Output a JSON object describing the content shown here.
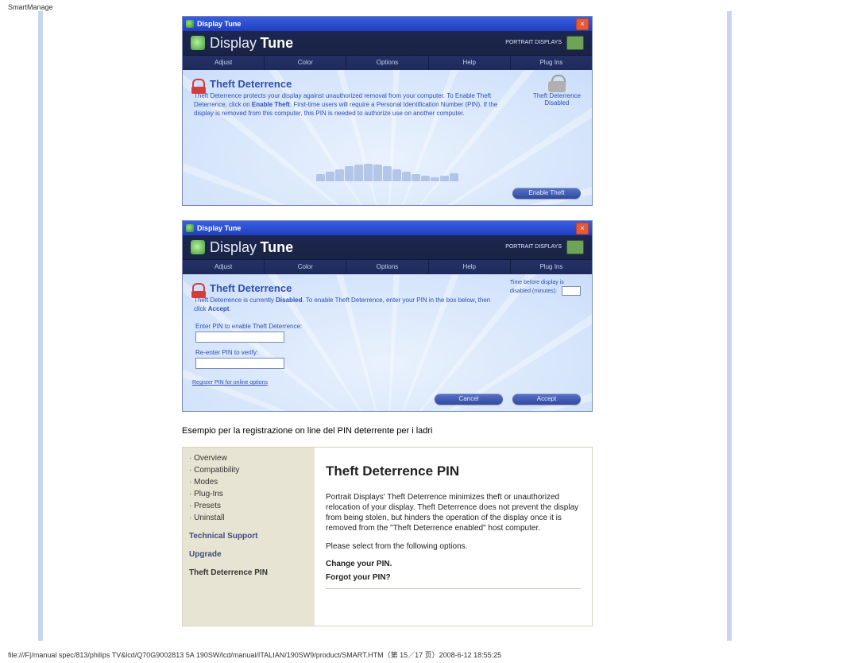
{
  "header": {
    "title": "SmartManage"
  },
  "app_common": {
    "window_title": "Display Tune",
    "brand_a": "Display",
    "brand_b": "Tune",
    "brand_label": "PORTRAIT\nDISPLAYS",
    "close_glyph": "×"
  },
  "window1": {
    "tabs": [
      "Adjust",
      "Color",
      "Options",
      "Help",
      "Plug Ins"
    ],
    "panel_title": "Theft Deterrence",
    "panel_desc": "Theft Deterrence protects your display against unauthorized removal from your computer. To Enable Theft Deterrence, click on <b>Enable Theft</b>. First-time users will require a Personal Identification Number (PIN). If the display is removed from this computer, this PIN is needed to authorize use on another computer.",
    "status_line1": "Theft Deterrence",
    "status_line2": "Disabled",
    "button": "Enable Theft"
  },
  "window2": {
    "tabs": [
      "Adjust",
      "Color",
      "Options",
      "Help",
      "Plug Ins"
    ],
    "panel_title": "Theft Deterrence",
    "panel_desc": "Theft Deterrence is currently <b>Disabled</b>. To enable Theft Deterrence, enter your PIN in the box below, then click <b>Accept</b>.",
    "field1_label": "Enter PIN to enable Theft Deterrence:",
    "field2_label": "Re-enter PIN to verify:",
    "right_status_a": "Time before display is",
    "right_status_b": "disabled (minutes):",
    "link": "Register PIN for online options",
    "button_cancel": "Cancel",
    "button_accept": "Accept"
  },
  "caption": "Esempio per la registrazione on line del PIN deterrente per i ladri",
  "help": {
    "side": {
      "items": [
        "Overview",
        "Compatibility",
        "Modes",
        "Plug-Ins",
        "Presets",
        "Uninstall"
      ],
      "tech": "Technical Support",
      "upgrade": "Upgrade",
      "pin": "Theft Deterrence PIN"
    },
    "title": "Theft Deterrence PIN",
    "para": "Portrait Displays' Theft Deterrence minimizes theft or unauthorized relocation of your display. Theft Deterrence does not prevent the display from being stolen, but hinders the operation of the display once it is removed from the \"Theft Deterrence enabled\" host computer.",
    "select": "Please select from the following options.",
    "opt1": "Change your PIN.",
    "opt2": "Forgot your PIN?"
  },
  "footer": "file:///F|/manual spec/813/philips TV&lcd/Q70G9002813 5A 190SW/lcd/manual/ITALIAN/190SW9/product/SMART.HTM（第 15／17 页）2008-6-12 18:55:25"
}
